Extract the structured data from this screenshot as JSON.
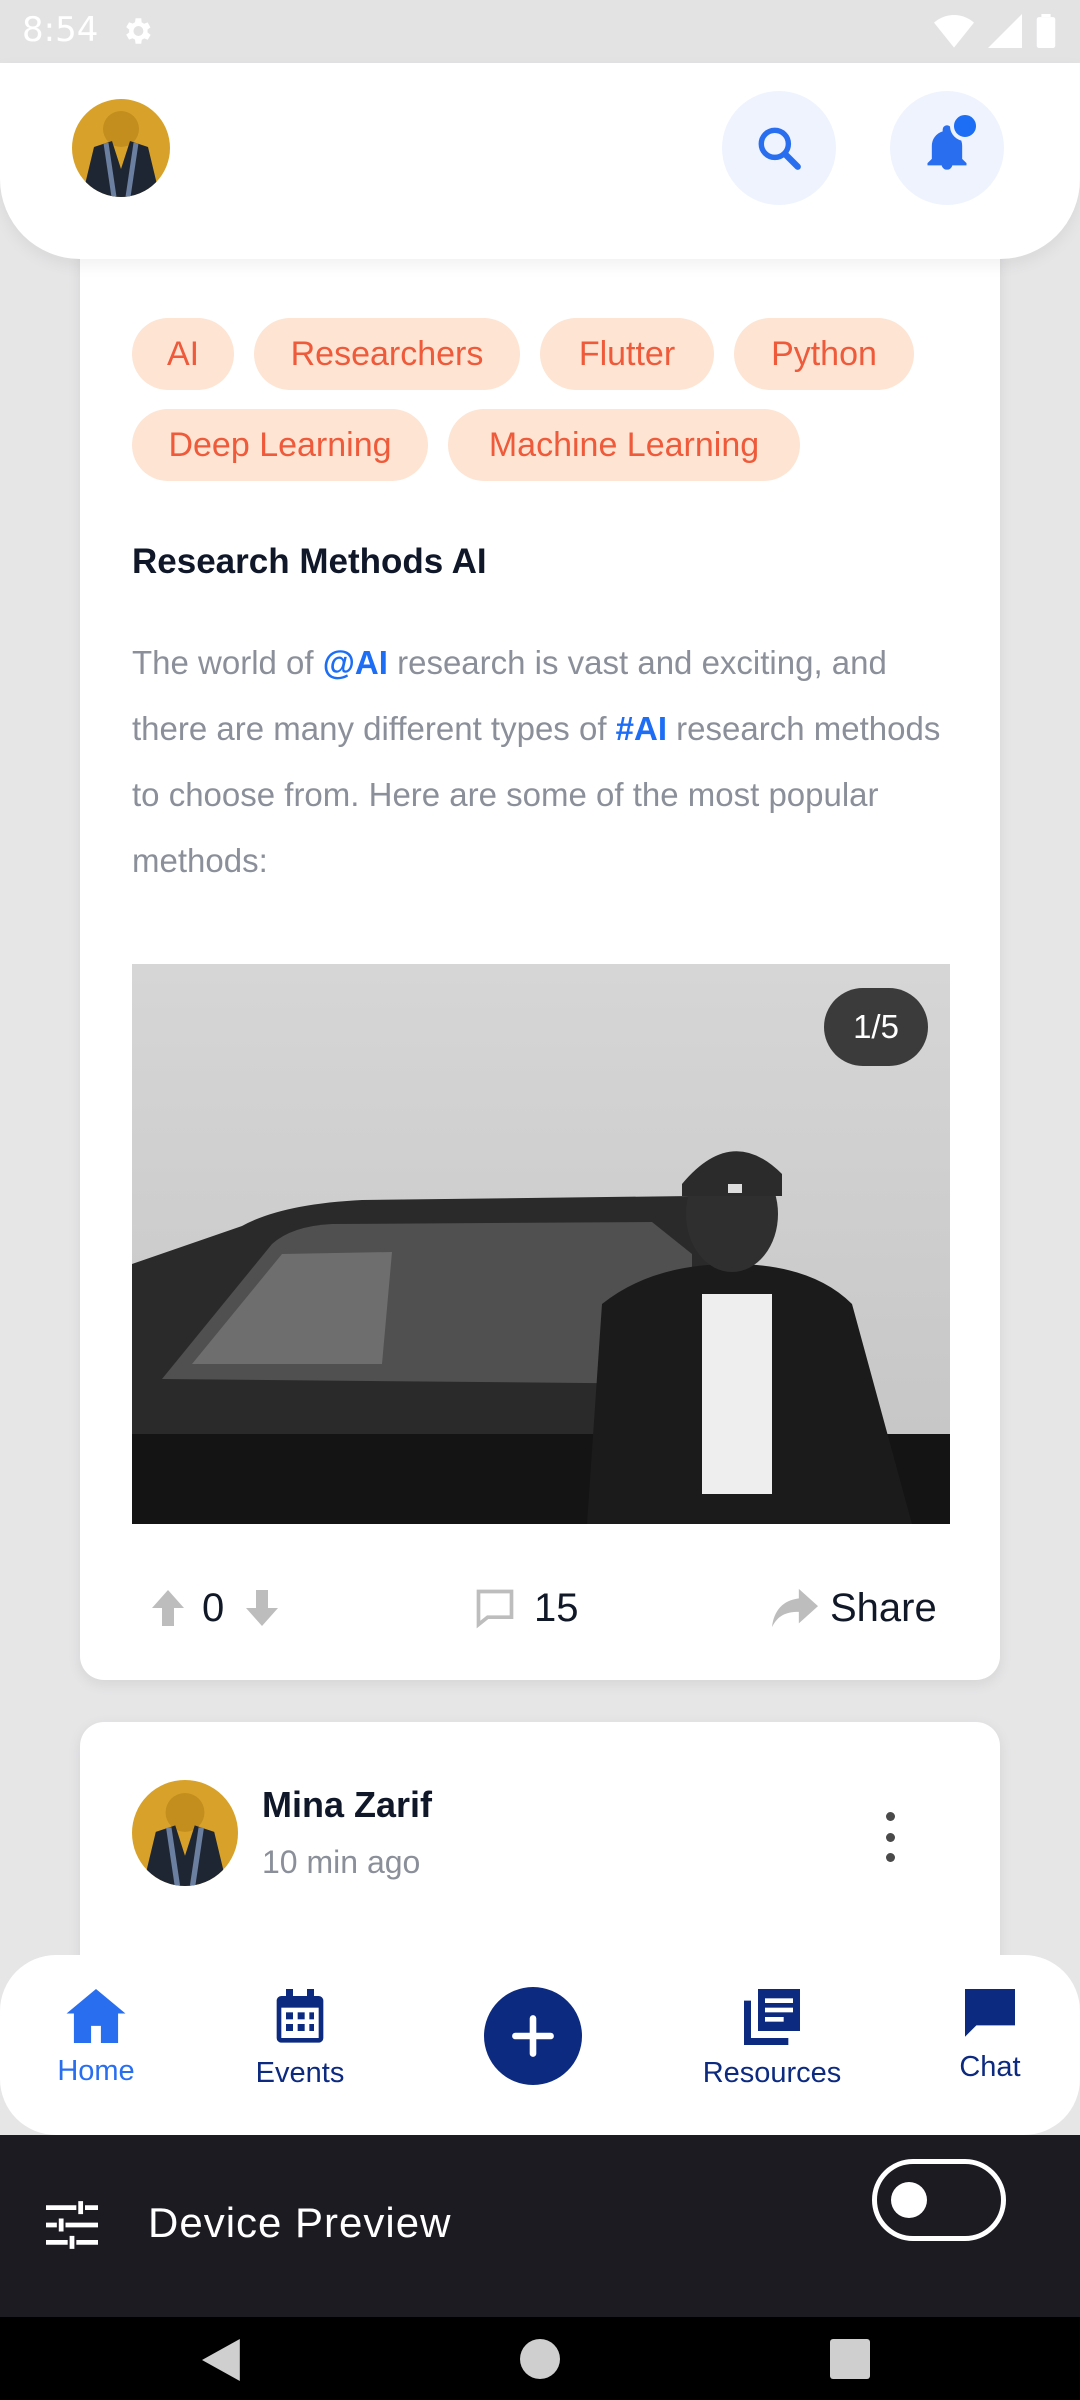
{
  "status_bar": {
    "time": "8:54"
  },
  "tags": [
    "AI",
    "Researchers",
    "Flutter",
    "Python",
    "Deep Learning",
    "Machine Learning"
  ],
  "post": {
    "title": "Research Methods AI",
    "body_1": "The world of ",
    "mention": "@AI",
    "body_2": " research is vast and exciting, and there are many different types of ",
    "hashtag": "#AI",
    "body_3": " research methods to choose from. Here are some of the most popular methods:",
    "image_counter": "1/5",
    "votes": "0",
    "comments": "15",
    "share_label": "Share"
  },
  "next_post": {
    "author": "Mina Zarif",
    "time": "10 min ago"
  },
  "bottom_nav": {
    "home": "Home",
    "events": "Events",
    "resources": "Resources",
    "chat": "Chat"
  },
  "device_preview": {
    "label": "Device Preview"
  },
  "colors": {
    "accent": "#1d6ef5",
    "navy": "#0c2a80",
    "chip_bg": "#fde4d3",
    "chip_text": "#ee5a3a"
  },
  "icons": [
    "gear-icon",
    "wifi-icon",
    "signal-icon",
    "battery-icon",
    "search-icon",
    "bell-icon",
    "upvote-icon",
    "downvote-icon",
    "comment-icon",
    "share-icon",
    "more-vert-icon",
    "home-icon",
    "calendar-icon",
    "plus-icon",
    "library-icon",
    "chat-icon",
    "tune-icon",
    "back-icon",
    "home-circle-icon",
    "recents-icon"
  ]
}
